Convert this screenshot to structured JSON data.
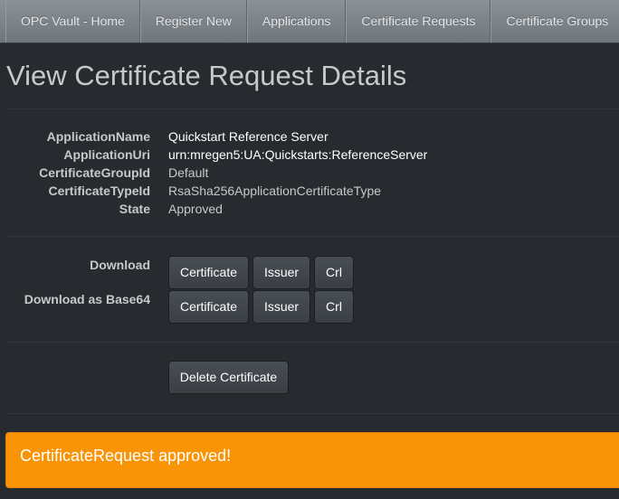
{
  "nav": [
    "OPC Vault - Home",
    "Register New",
    "Applications",
    "Certificate Requests",
    "Certificate Groups"
  ],
  "page_title": "View Certificate Request Details",
  "details": [
    {
      "label": "ApplicationName",
      "value": "Quickstart Reference Server"
    },
    {
      "label": "ApplicationUri",
      "value": "urn:mregen5:UA:Quickstarts:ReferenceServer"
    },
    {
      "label": "CertificateGroupId",
      "value": "Default"
    },
    {
      "label": "CertificateTypeId",
      "value": "RsaSha256ApplicationCertificateType"
    },
    {
      "label": "State",
      "value": "Approved"
    }
  ],
  "download": {
    "label": "Download",
    "certificate": "Certificate",
    "issuer": "Issuer",
    "crl": "Crl"
  },
  "download_base64": {
    "label": "Download as Base64",
    "certificate": "Certificate",
    "issuer": "Issuer",
    "crl": "Crl"
  },
  "delete_label": "Delete Certificate",
  "alert": "CertificateRequest approved!",
  "colors": {
    "alert": "#f89406",
    "background": "#272b30"
  }
}
